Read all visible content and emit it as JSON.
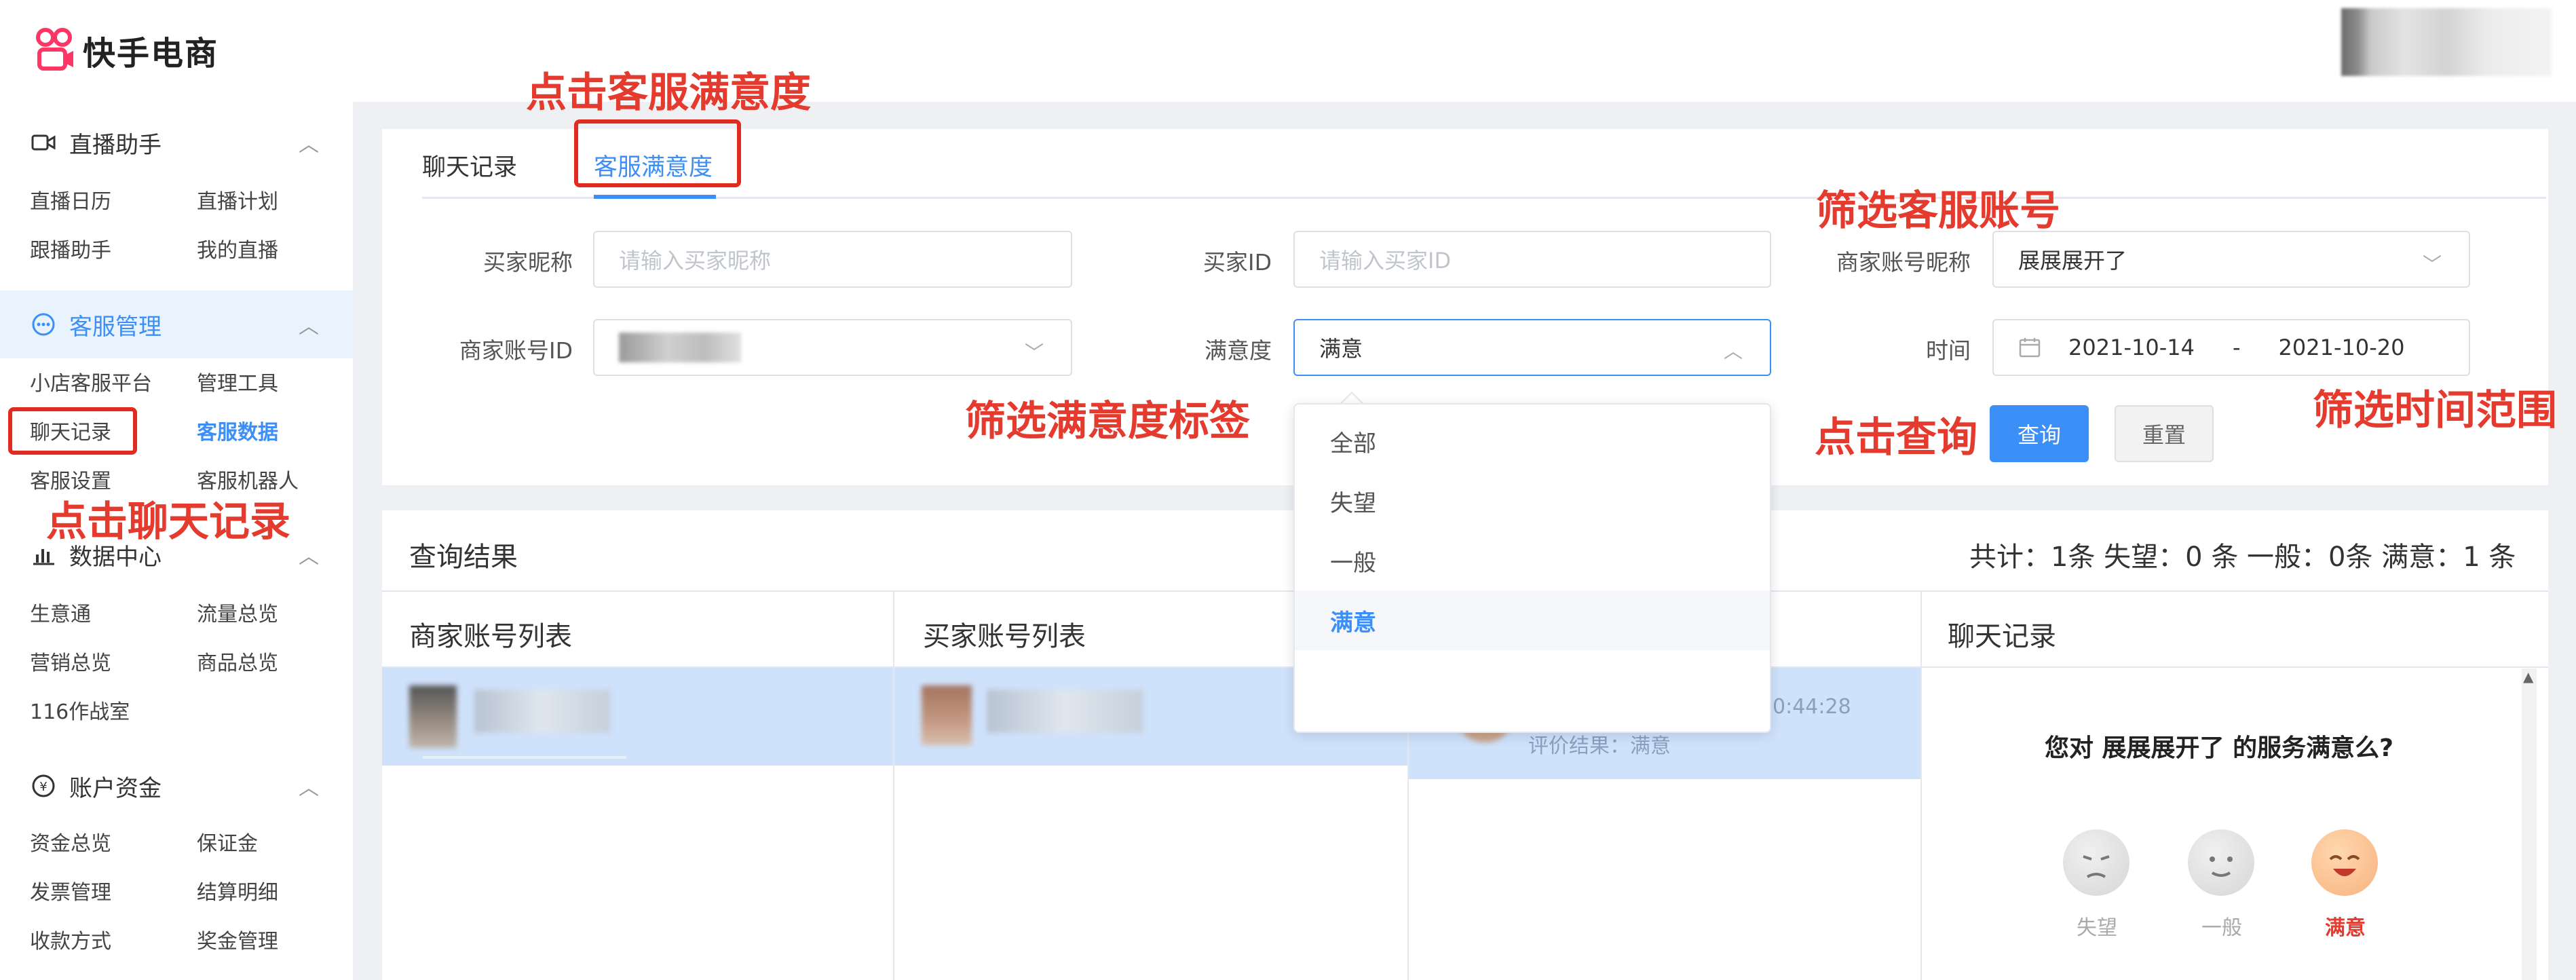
{
  "app": {
    "title": "快手电商"
  },
  "sidebar": {
    "sections": [
      {
        "title": "直播助手",
        "items": [
          "直播日历",
          "直播计划",
          "跟播助手",
          "我的直播"
        ]
      },
      {
        "title": "客服管理",
        "items": [
          "小店客服平台",
          "管理工具",
          "聊天记录",
          "客服数据",
          "客服设置",
          "客服机器人"
        ]
      },
      {
        "title": "数据中心",
        "items": [
          "生意通",
          "流量总览",
          "营销总览",
          "商品总览",
          "116作战室"
        ]
      },
      {
        "title": "账户资金",
        "items": [
          "资金总览",
          "保证金",
          "发票管理",
          "结算明细",
          "收款方式",
          "奖金管理"
        ]
      }
    ]
  },
  "tabs": {
    "chat": "聊天记录",
    "satisfaction": "客服满意度"
  },
  "filters": {
    "buyer_nick_label": "买家昵称",
    "buyer_nick_placeholder": "请输入买家昵称",
    "buyer_id_label": "买家ID",
    "buyer_id_placeholder": "请输入买家ID",
    "merchant_nick_label": "商家账号昵称",
    "merchant_nick_value": "展展展开了",
    "merchant_id_label": "商家账号ID",
    "satisfaction_label": "满意度",
    "satisfaction_value": "满意",
    "time_label": "时间",
    "date_start": "2021-10-14",
    "date_sep": "-",
    "date_end": "2021-10-20",
    "query_button": "查询",
    "reset_button": "重置"
  },
  "dropdown": {
    "options": [
      "全部",
      "失望",
      "一般",
      "满意"
    ],
    "selected": "满意"
  },
  "results": {
    "title": "查询结果",
    "summary": "共计：1条 失望：0 条 一般：0条 满意：1 条",
    "col_merchants": "商家账号列表",
    "col_buyers": "买家账号列表",
    "col_chat": "聊天记录",
    "record_time": "0:44:28",
    "record_result": "评价结果：满意"
  },
  "survey": {
    "question": "您对 展展展开了 的服务满意么?",
    "options": [
      "失望",
      "一般",
      "满意"
    ]
  },
  "annotations": {
    "click_satisfaction": "点击客服满意度",
    "filter_account": "筛选客服账号",
    "filter_satisfaction": "筛选满意度标签",
    "click_query": "点击查询",
    "filter_time": "筛选时间范围",
    "click_chat": "点击聊天记录"
  },
  "colors": {
    "accent": "#3b8ff7",
    "annotation": "#e53a2e",
    "brand": "#fe3666"
  }
}
